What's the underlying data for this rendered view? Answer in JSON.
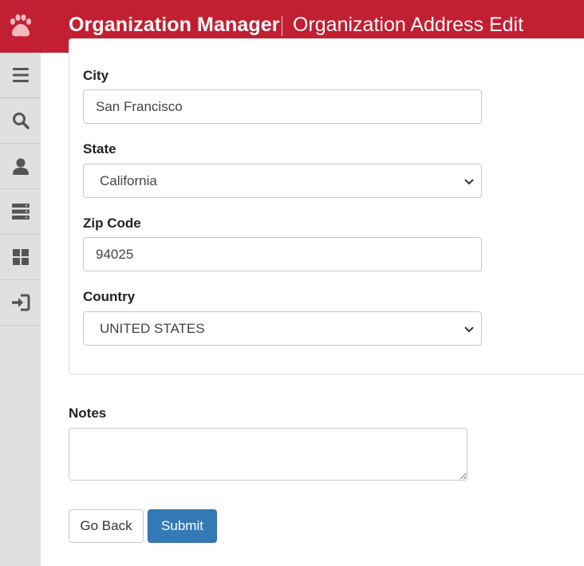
{
  "header": {
    "app_title": "Organization Manager",
    "page_title": "Organization Address Edit",
    "background_color": "#c21f32",
    "logo_icon": "paw-icon"
  },
  "sidebar": {
    "items": [
      {
        "name": "menu",
        "icon": "hamburger-icon"
      },
      {
        "name": "search",
        "icon": "search-icon"
      },
      {
        "name": "user",
        "icon": "user-icon"
      },
      {
        "name": "servers",
        "icon": "server-icon"
      },
      {
        "name": "dashboard",
        "icon": "grid-icon"
      },
      {
        "name": "logout",
        "icon": "logout-icon"
      }
    ]
  },
  "form": {
    "city": {
      "label": "City",
      "value": "San Francisco"
    },
    "state": {
      "label": "State",
      "value": "California"
    },
    "zip": {
      "label": "Zip Code",
      "value": "94025"
    },
    "country": {
      "label": "Country",
      "value": "UNITED STATES"
    },
    "notes": {
      "label": "Notes",
      "value": ""
    }
  },
  "actions": {
    "back_label": "Go Back",
    "submit_label": "Submit",
    "primary_color": "#337ab7"
  }
}
